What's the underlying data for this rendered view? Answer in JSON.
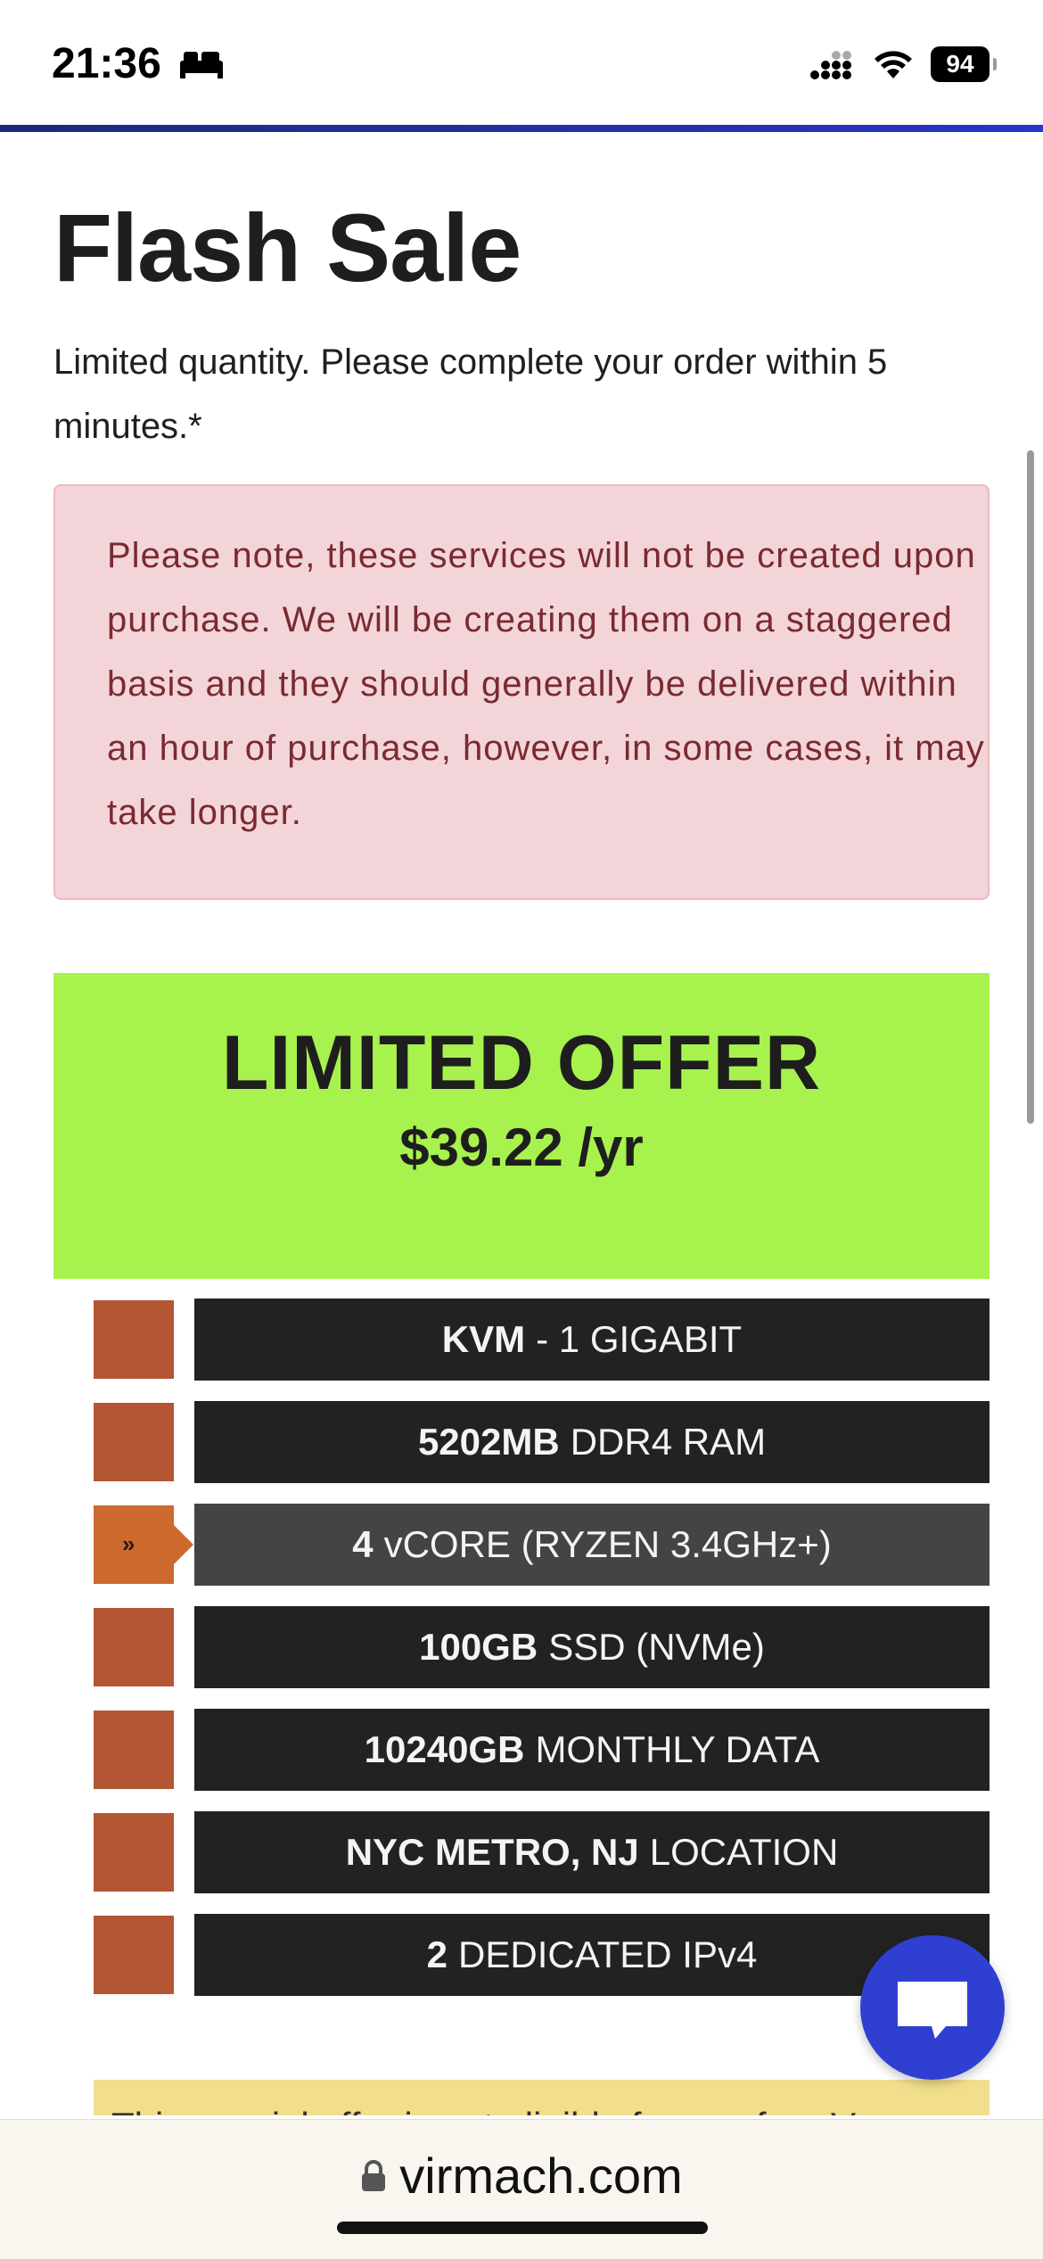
{
  "status_bar": {
    "time": "21:36",
    "battery": "94",
    "icons": [
      "bed-icon",
      "signal-icon",
      "wifi-icon",
      "battery-icon"
    ]
  },
  "page": {
    "title_bold": "Flash",
    "title_rest": "Sale",
    "intro": "Limited quantity. Please complete your order within 5 minutes.*",
    "notice": "Please note, these services will not be created upon purchase. We will be creating them on a staggered basis and they should generally be delivered within an hour of purchase, however, in some cases, it may take longer."
  },
  "offer": {
    "title": "LIMITED OFFER",
    "price": "$39.22 /yr",
    "bg_color": "#a8f24d"
  },
  "features": [
    {
      "bold": "KVM",
      "text": "- 1 GIGABIT",
      "active": false
    },
    {
      "bold": "5202MB",
      "text": "DDR4 RAM",
      "active": false
    },
    {
      "bold": "4",
      "text": "vCORE (RYZEN 3.4GHz+)",
      "active": true,
      "marker": "»"
    },
    {
      "bold": "100GB",
      "text": "SSD (NVMe)",
      "active": false
    },
    {
      "bold": "10240GB",
      "text": "MONTHLY DATA",
      "active": false
    },
    {
      "bold": "NYC METRO, NJ",
      "text": "LOCATION",
      "active": false
    },
    {
      "bold": "2",
      "text": "DEDICATED IPv4",
      "active": false
    }
  ],
  "yellow_strip_text": "This special offer is not eligible for any free V",
  "browser": {
    "url": "virmach.com"
  },
  "colors": {
    "accent_blue": "#2f40d1",
    "feature_marker": "#b45533",
    "notice_text": "#7a2a31"
  }
}
